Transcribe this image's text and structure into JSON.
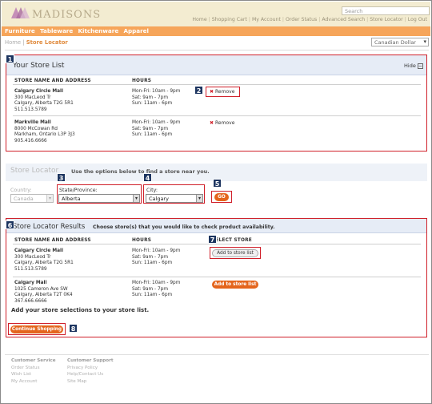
{
  "header": {
    "brand": "MADISONS",
    "search_placeholder": "Search",
    "links": [
      "Home",
      "Shopping Cart",
      "My Account",
      "Order Status",
      "Advanced Search",
      "Store Locator",
      "Log Out"
    ],
    "nav": [
      "Furniture",
      "Tableware",
      "Kitchenware",
      "Apparel"
    ]
  },
  "breadcrumb": {
    "home": "Home",
    "sep": "|",
    "current": "Store Locator"
  },
  "currency": {
    "selected": "Canadian Dollar"
  },
  "store_list": {
    "title": "Your Store List",
    "hide_label": "Hide",
    "col_store": "STORE NAME AND ADDRESS",
    "col_hours": "HOURS",
    "remove_label": "Remove",
    "stores": [
      {
        "name": "Calgary Circle Mall",
        "line1": "300 MacLeod Tr",
        "line2": "Calgary, Alberta T2G 5R1",
        "phone": "511.513.5789",
        "h1": "Mon-Fri: 10am - 9pm",
        "h2": "Sat: 9am - 7pm",
        "h3": "Sun: 11am - 6pm"
      },
      {
        "name": "Markville Mall",
        "line1": "8000 McCowan Rd",
        "line2": "Markham, Ontario L3P 3J3",
        "phone": "905.416.6666",
        "h1": "Mon-Fri: 10am - 9pm",
        "h2": "Sat: 9am - 7pm",
        "h3": "Sun: 11am - 6pm"
      }
    ]
  },
  "locator": {
    "title": "Store Locator",
    "instruction": "Use the options below to find a store near you.",
    "country_label": "Country:",
    "country_value": "Canada",
    "state_label": "State/Province:",
    "state_value": "Alberta",
    "city_label": "City:",
    "city_value": "Calgary",
    "go_label": "GO"
  },
  "results": {
    "title": "Store Locator Results",
    "instruction": "Choose store(s) that you would like to check product availability.",
    "col_store": "STORE NAME AND ADDRESS",
    "col_hours": "HOURS",
    "col_select": "SELECT STORE",
    "add_label": "Add to store list",
    "stores": [
      {
        "name": "Calgary Circle Mall",
        "line1": "300 MacLeod Tr",
        "line2": "Calgary, Alberta T2G 5R1",
        "phone": "511.513.5789",
        "h1": "Mon-Fri: 10am - 9pm",
        "h2": "Sat: 9am - 7pm",
        "h3": "Sun: 11am - 6pm"
      },
      {
        "name": "Calgary Mall",
        "line1": "1025 Cameron Ave SW",
        "line2": "Calgary, Alberta T2T 0K4",
        "phone": "367.666.6666",
        "h1": "Mon-Fri: 10am - 9pm",
        "h2": "Sat: 9am - 7pm",
        "h3": "Sun: 11am - 6pm"
      }
    ],
    "add_selections_text": "Add your store selections to your store list.",
    "continue_label": "Continue Shopping"
  },
  "callouts": [
    "1",
    "2",
    "3",
    "4",
    "5",
    "6",
    "7",
    "8"
  ],
  "footer": {
    "col1_title": "Customer Service",
    "col1": [
      "Order Status",
      "Wish List",
      "My Account"
    ],
    "col2_title": "Customer Support",
    "col2": [
      "Privacy Policy",
      "Help/Contact Us",
      "Site Map"
    ]
  },
  "colors": {
    "accent": "#e4651d",
    "nav": "#f6a55a",
    "callout": "#1d3560",
    "highlight": "#d0202a"
  }
}
